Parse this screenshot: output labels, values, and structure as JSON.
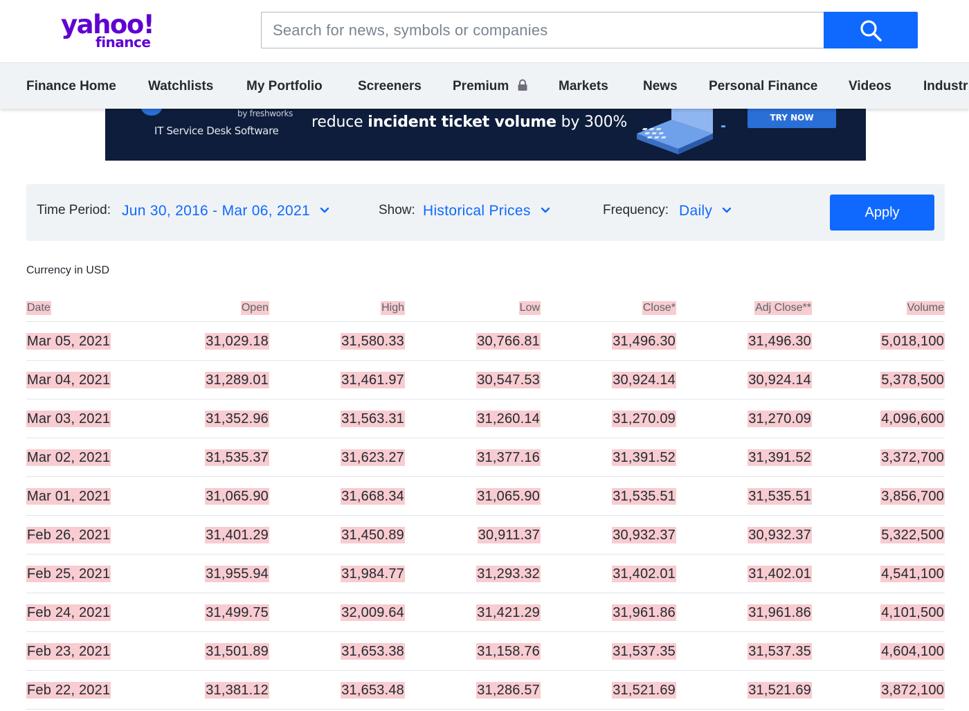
{
  "brand": {
    "logo_main": "yahoo!",
    "logo_sub": "finance",
    "logo_color": "#6001d2"
  },
  "search": {
    "placeholder": "Search for news, symbols or companies",
    "value": "",
    "button_icon": "search-icon",
    "button_color": "#0f69ff"
  },
  "nav": {
    "items": [
      {
        "label": "Finance Home"
      },
      {
        "label": "Watchlists"
      },
      {
        "label": "My Portfolio"
      },
      {
        "label": "Screeners"
      },
      {
        "label": "Premium",
        "icon": "lock-icon"
      },
      {
        "label": "Markets"
      },
      {
        "label": "News"
      },
      {
        "label": "Personal Finance"
      },
      {
        "label": "Videos"
      },
      {
        "label": "Industr"
      }
    ]
  },
  "ad": {
    "by_line": "by freshworks",
    "subtitle": "IT Service Desk Software",
    "headline_pre": "reduce ",
    "headline_bold": "incident ticket volume",
    "headline_post": " by 300%",
    "cta": "TRY NOW",
    "background": "#0e1d3b"
  },
  "filter": {
    "time_period_label": "Time Period:",
    "time_period_value": "Jun 30, 2016 - Mar 06, 2021",
    "show_label": "Show:",
    "show_value": "Historical Prices",
    "frequency_label": "Frequency:",
    "frequency_value": "Daily",
    "apply_label": "Apply",
    "accent": "#0f69ff"
  },
  "currency_note": "Currency in USD",
  "table": {
    "headers": {
      "date": "Date",
      "open": "Open",
      "high": "High",
      "low": "Low",
      "close": "Close*",
      "adj_close": "Adj Close**",
      "volume": "Volume"
    },
    "rows": [
      {
        "date": "Mar 05, 2021",
        "open": "31,029.18",
        "high": "31,580.33",
        "low": "30,766.81",
        "close": "31,496.30",
        "adj_close": "31,496.30",
        "volume": "5,018,100"
      },
      {
        "date": "Mar 04, 2021",
        "open": "31,289.01",
        "high": "31,461.97",
        "low": "30,547.53",
        "close": "30,924.14",
        "adj_close": "30,924.14",
        "volume": "5,378,500"
      },
      {
        "date": "Mar 03, 2021",
        "open": "31,352.96",
        "high": "31,563.31",
        "low": "31,260.14",
        "close": "31,270.09",
        "adj_close": "31,270.09",
        "volume": "4,096,600"
      },
      {
        "date": "Mar 02, 2021",
        "open": "31,535.37",
        "high": "31,623.27",
        "low": "31,377.16",
        "close": "31,391.52",
        "adj_close": "31,391.52",
        "volume": "3,372,700"
      },
      {
        "date": "Mar 01, 2021",
        "open": "31,065.90",
        "high": "31,668.34",
        "low": "31,065.90",
        "close": "31,535.51",
        "adj_close": "31,535.51",
        "volume": "3,856,700"
      },
      {
        "date": "Feb 26, 2021",
        "open": "31,401.29",
        "high": "31,450.89",
        "low": "30,911.37",
        "close": "30,932.37",
        "adj_close": "30,932.37",
        "volume": "5,322,500"
      },
      {
        "date": "Feb 25, 2021",
        "open": "31,955.94",
        "high": "31,984.77",
        "low": "31,293.32",
        "close": "31,402.01",
        "adj_close": "31,402.01",
        "volume": "4,541,100"
      },
      {
        "date": "Feb 24, 2021",
        "open": "31,499.75",
        "high": "32,009.64",
        "low": "31,421.29",
        "close": "31,961.86",
        "adj_close": "31,961.86",
        "volume": "4,101,500"
      },
      {
        "date": "Feb 23, 2021",
        "open": "31,501.89",
        "high": "31,653.38",
        "low": "31,158.76",
        "close": "31,537.35",
        "adj_close": "31,537.35",
        "volume": "4,604,100"
      },
      {
        "date": "Feb 22, 2021",
        "open": "31,381.12",
        "high": "31,653.48",
        "low": "31,286.57",
        "close": "31,521.69",
        "adj_close": "31,521.69",
        "volume": "3,872,100"
      }
    ],
    "highlight_color": "#f8ccd0"
  }
}
